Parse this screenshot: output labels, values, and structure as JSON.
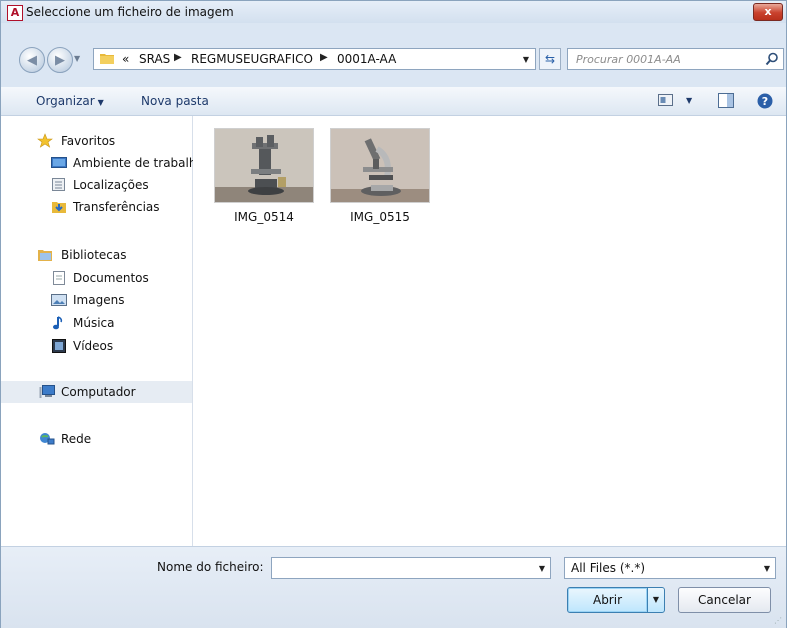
{
  "window": {
    "title": "Seleccione um ficheiro de imagem",
    "app_icon": "A",
    "close_glyph": "x"
  },
  "navigation": {
    "back_icon": "back-arrow-icon",
    "forward_icon": "forward-arrow-icon",
    "breadcrumb_overflow": "«",
    "breadcrumbs": [
      "SRAS",
      "REGMUSEUGRAFICO",
      "0001A-AA"
    ],
    "search_placeholder": "Procurar 0001A-AA"
  },
  "toolbar": {
    "organize_label": "Organizar",
    "new_folder_label": "Nova pasta"
  },
  "sidebar": {
    "favorites": {
      "label": "Favoritos",
      "items": [
        "Ambiente de trabalh",
        "Localizações",
        "Transferências"
      ]
    },
    "libraries": {
      "label": "Bibliotecas",
      "items": [
        "Documentos",
        "Imagens",
        "Música",
        "Vídeos"
      ]
    },
    "computer": "Computador",
    "network": "Rede"
  },
  "files": [
    {
      "name": "IMG_0514"
    },
    {
      "name": "IMG_0515"
    }
  ],
  "footer": {
    "file_name_label": "Nome do ficheiro:",
    "file_name_value": "",
    "filter_value": "All Files (*.*)",
    "open_label": "Abrir",
    "cancel_label": "Cancelar"
  },
  "colors": {
    "accent": "#3c7fb1",
    "window_bg": "#dbe6f3",
    "close_red": "#c9412d"
  }
}
